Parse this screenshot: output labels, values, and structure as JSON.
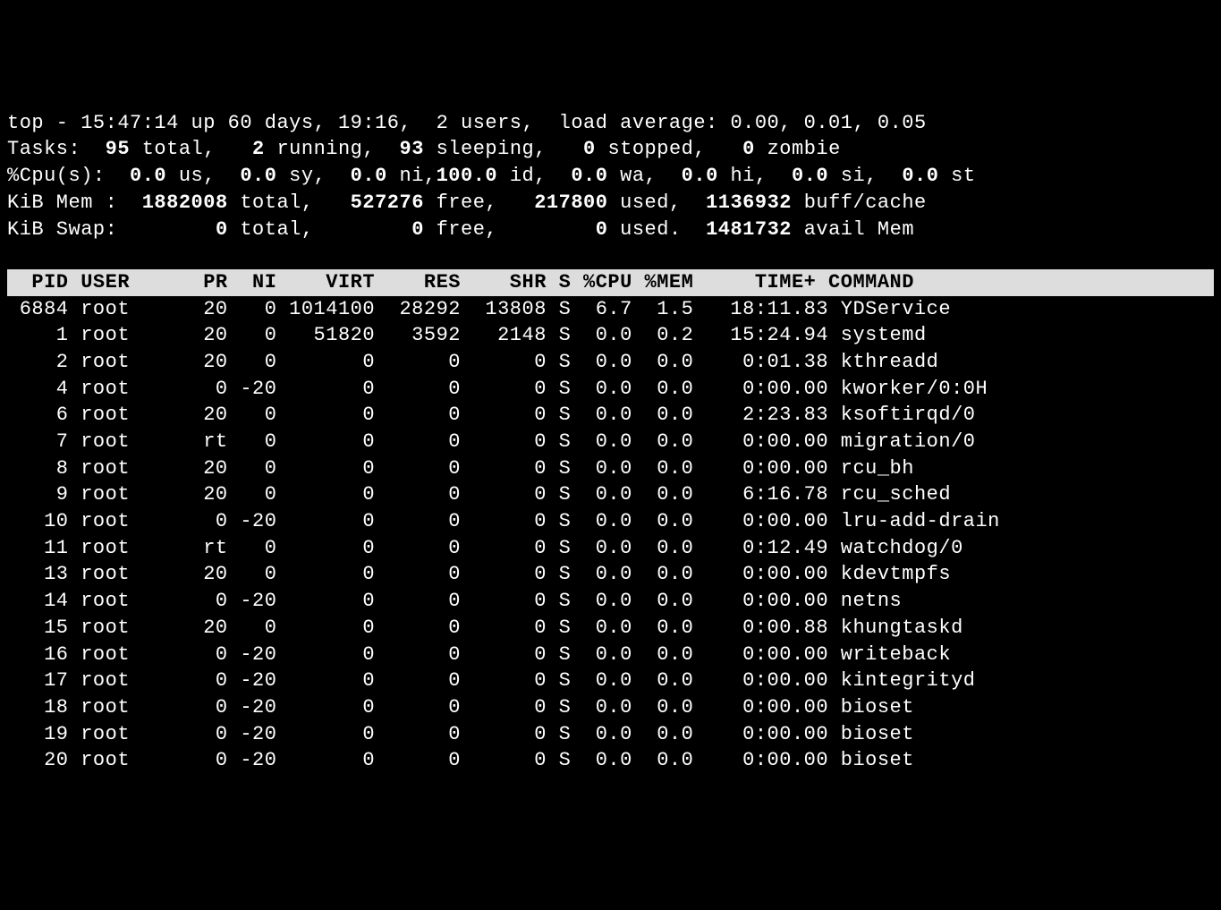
{
  "summary": {
    "line1_prefix": "top - ",
    "time": "15:47:14",
    "up_text": " up 60 days, 19:16,  2 users,  load average: 0.00, 0.01, 0.05",
    "tasks_label": "Tasks:",
    "tasks_total": "  95 ",
    "tasks_total_label": "total,",
    "tasks_running": "   2 ",
    "tasks_running_label": "running,",
    "tasks_sleeping": "  93 ",
    "tasks_sleeping_label": "sleeping,",
    "tasks_stopped": "   0 ",
    "tasks_stopped_label": "stopped,",
    "tasks_zombie": "   0 ",
    "tasks_zombie_label": "zombie",
    "cpu_label": "%Cpu(s):",
    "cpu_us": "  0.0 ",
    "cpu_us_label": "us,",
    "cpu_sy": "  0.0 ",
    "cpu_sy_label": "sy,",
    "cpu_ni": "  0.0 ",
    "cpu_ni_label": "ni,",
    "cpu_id": "100.0 ",
    "cpu_id_label": "id,",
    "cpu_wa": "  0.0 ",
    "cpu_wa_label": "wa,",
    "cpu_hi": "  0.0 ",
    "cpu_hi_label": "hi,",
    "cpu_si": "  0.0 ",
    "cpu_si_label": "si,",
    "cpu_st": "  0.0 ",
    "cpu_st_label": "st",
    "mem_label": "KiB Mem :",
    "mem_total": "  1882008 ",
    "mem_total_label": "total,",
    "mem_free": "   527276 ",
    "mem_free_label": "free,",
    "mem_used": "   217800 ",
    "mem_used_label": "used,",
    "mem_buff": "  1136932 ",
    "mem_buff_label": "buff/cache",
    "swap_label": "KiB Swap:",
    "swap_total": "        0 ",
    "swap_total_label": "total,",
    "swap_free": "        0 ",
    "swap_free_label": "free,",
    "swap_used": "        0 ",
    "swap_used_label": "used.",
    "swap_avail": "  1481732 ",
    "swap_avail_label": "avail Mem "
  },
  "headers": {
    "text": "  PID USER      PR  NI    VIRT    RES    SHR S %CPU %MEM     TIME+ COMMAND                      "
  },
  "processes": [
    {
      "pid": " 6884",
      "user": "root",
      "pr": "20",
      "ni": "  0",
      "virt": "1014100",
      "res": " 28292",
      "shr": " 13808",
      "s": "S",
      "cpu": " 6.7",
      "mem": " 1.5",
      "time": "  18:11.83",
      "cmd": "YDService"
    },
    {
      "pid": "    1",
      "user": "root",
      "pr": "20",
      "ni": "  0",
      "virt": "  51820",
      "res": "  3592",
      "shr": "  2148",
      "s": "S",
      "cpu": " 0.0",
      "mem": " 0.2",
      "time": "  15:24.94",
      "cmd": "systemd"
    },
    {
      "pid": "    2",
      "user": "root",
      "pr": "20",
      "ni": "  0",
      "virt": "      0",
      "res": "     0",
      "shr": "     0",
      "s": "S",
      "cpu": " 0.0",
      "mem": " 0.0",
      "time": "   0:01.38",
      "cmd": "kthreadd"
    },
    {
      "pid": "    4",
      "user": "root",
      "pr": " 0",
      "ni": "-20",
      "virt": "      0",
      "res": "     0",
      "shr": "     0",
      "s": "S",
      "cpu": " 0.0",
      "mem": " 0.0",
      "time": "   0:00.00",
      "cmd": "kworker/0:0H"
    },
    {
      "pid": "    6",
      "user": "root",
      "pr": "20",
      "ni": "  0",
      "virt": "      0",
      "res": "     0",
      "shr": "     0",
      "s": "S",
      "cpu": " 0.0",
      "mem": " 0.0",
      "time": "   2:23.83",
      "cmd": "ksoftirqd/0"
    },
    {
      "pid": "    7",
      "user": "root",
      "pr": "rt",
      "ni": "  0",
      "virt": "      0",
      "res": "     0",
      "shr": "     0",
      "s": "S",
      "cpu": " 0.0",
      "mem": " 0.0",
      "time": "   0:00.00",
      "cmd": "migration/0"
    },
    {
      "pid": "    8",
      "user": "root",
      "pr": "20",
      "ni": "  0",
      "virt": "      0",
      "res": "     0",
      "shr": "     0",
      "s": "S",
      "cpu": " 0.0",
      "mem": " 0.0",
      "time": "   0:00.00",
      "cmd": "rcu_bh"
    },
    {
      "pid": "    9",
      "user": "root",
      "pr": "20",
      "ni": "  0",
      "virt": "      0",
      "res": "     0",
      "shr": "     0",
      "s": "S",
      "cpu": " 0.0",
      "mem": " 0.0",
      "time": "   6:16.78",
      "cmd": "rcu_sched"
    },
    {
      "pid": "   10",
      "user": "root",
      "pr": " 0",
      "ni": "-20",
      "virt": "      0",
      "res": "     0",
      "shr": "     0",
      "s": "S",
      "cpu": " 0.0",
      "mem": " 0.0",
      "time": "   0:00.00",
      "cmd": "lru-add-drain"
    },
    {
      "pid": "   11",
      "user": "root",
      "pr": "rt",
      "ni": "  0",
      "virt": "      0",
      "res": "     0",
      "shr": "     0",
      "s": "S",
      "cpu": " 0.0",
      "mem": " 0.0",
      "time": "   0:12.49",
      "cmd": "watchdog/0"
    },
    {
      "pid": "   13",
      "user": "root",
      "pr": "20",
      "ni": "  0",
      "virt": "      0",
      "res": "     0",
      "shr": "     0",
      "s": "S",
      "cpu": " 0.0",
      "mem": " 0.0",
      "time": "   0:00.00",
      "cmd": "kdevtmpfs"
    },
    {
      "pid": "   14",
      "user": "root",
      "pr": " 0",
      "ni": "-20",
      "virt": "      0",
      "res": "     0",
      "shr": "     0",
      "s": "S",
      "cpu": " 0.0",
      "mem": " 0.0",
      "time": "   0:00.00",
      "cmd": "netns"
    },
    {
      "pid": "   15",
      "user": "root",
      "pr": "20",
      "ni": "  0",
      "virt": "      0",
      "res": "     0",
      "shr": "     0",
      "s": "S",
      "cpu": " 0.0",
      "mem": " 0.0",
      "time": "   0:00.88",
      "cmd": "khungtaskd"
    },
    {
      "pid": "   16",
      "user": "root",
      "pr": " 0",
      "ni": "-20",
      "virt": "      0",
      "res": "     0",
      "shr": "     0",
      "s": "S",
      "cpu": " 0.0",
      "mem": " 0.0",
      "time": "   0:00.00",
      "cmd": "writeback"
    },
    {
      "pid": "   17",
      "user": "root",
      "pr": " 0",
      "ni": "-20",
      "virt": "      0",
      "res": "     0",
      "shr": "     0",
      "s": "S",
      "cpu": " 0.0",
      "mem": " 0.0",
      "time": "   0:00.00",
      "cmd": "kintegrityd"
    },
    {
      "pid": "   18",
      "user": "root",
      "pr": " 0",
      "ni": "-20",
      "virt": "      0",
      "res": "     0",
      "shr": "     0",
      "s": "S",
      "cpu": " 0.0",
      "mem": " 0.0",
      "time": "   0:00.00",
      "cmd": "bioset"
    },
    {
      "pid": "   19",
      "user": "root",
      "pr": " 0",
      "ni": "-20",
      "virt": "      0",
      "res": "     0",
      "shr": "     0",
      "s": "S",
      "cpu": " 0.0",
      "mem": " 0.0",
      "time": "   0:00.00",
      "cmd": "bioset"
    },
    {
      "pid": "   20",
      "user": "root",
      "pr": " 0",
      "ni": "-20",
      "virt": "      0",
      "res": "     0",
      "shr": "     0",
      "s": "S",
      "cpu": " 0.0",
      "mem": " 0.0",
      "time": "   0:00.00",
      "cmd": "bioset"
    }
  ]
}
